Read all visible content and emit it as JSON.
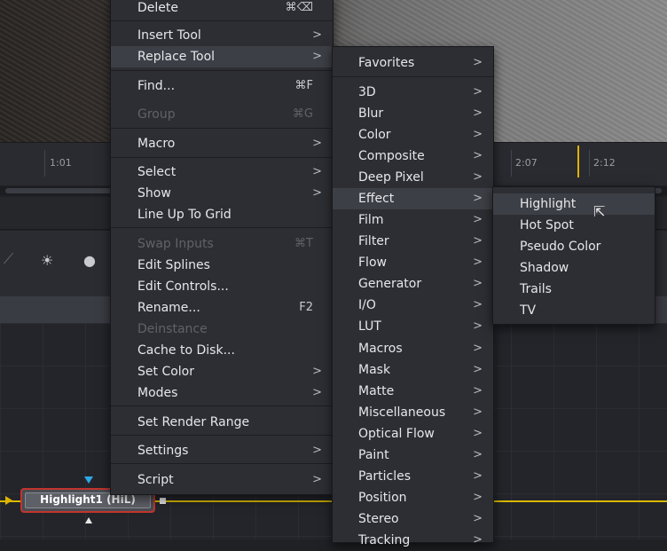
{
  "timeline": {
    "ticks": [
      "1:01",
      "2:07",
      "2:12"
    ]
  },
  "node": {
    "label": "Highlight1 (HiL)"
  },
  "context_menu": {
    "items": [
      {
        "label": "Delete",
        "shortcut": "⌘⌫",
        "disabled": false
      },
      {
        "label": "Insert Tool",
        "submenu": true
      },
      {
        "label": "Replace Tool",
        "submenu": true,
        "highlighted": true
      },
      {
        "label": "Find...",
        "shortcut": "⌘F"
      },
      {
        "label": "Group",
        "shortcut": "⌘G",
        "disabled": true
      },
      {
        "label": "Macro",
        "submenu": true
      },
      {
        "label": "Select",
        "submenu": true
      },
      {
        "label": "Show",
        "submenu": true
      },
      {
        "label": "Line Up To Grid"
      },
      {
        "label": "Swap Inputs",
        "shortcut": "⌘T",
        "disabled": true
      },
      {
        "label": "Edit Splines"
      },
      {
        "label": "Edit Controls..."
      },
      {
        "label": "Rename...",
        "shortcut": "F2"
      },
      {
        "label": "Deinstance",
        "disabled": true
      },
      {
        "label": "Cache to Disk..."
      },
      {
        "label": "Set Color",
        "submenu": true
      },
      {
        "label": "Modes",
        "submenu": true
      },
      {
        "label": "Set Render Range"
      },
      {
        "label": "Settings",
        "submenu": true
      },
      {
        "label": "Script",
        "submenu": true
      }
    ]
  },
  "replace_menu": {
    "items": [
      {
        "label": "Favorites"
      },
      {
        "label": "3D"
      },
      {
        "label": "Blur"
      },
      {
        "label": "Color"
      },
      {
        "label": "Composite"
      },
      {
        "label": "Deep Pixel"
      },
      {
        "label": "Effect",
        "highlighted": true
      },
      {
        "label": "Film"
      },
      {
        "label": "Filter"
      },
      {
        "label": "Flow"
      },
      {
        "label": "Generator"
      },
      {
        "label": "I/O"
      },
      {
        "label": "LUT"
      },
      {
        "label": "Macros"
      },
      {
        "label": "Mask"
      },
      {
        "label": "Matte"
      },
      {
        "label": "Miscellaneous"
      },
      {
        "label": "Optical Flow"
      },
      {
        "label": "Paint"
      },
      {
        "label": "Particles"
      },
      {
        "label": "Position"
      },
      {
        "label": "Stereo"
      },
      {
        "label": "Tracking"
      }
    ]
  },
  "effect_menu": {
    "items": [
      {
        "label": "Highlight",
        "highlighted": true
      },
      {
        "label": "Hot Spot"
      },
      {
        "label": "Pseudo Color"
      },
      {
        "label": "Shadow"
      },
      {
        "label": "Trails"
      },
      {
        "label": "TV"
      }
    ]
  },
  "colors": {
    "playhead": "#e0b300",
    "node_selected_border": "#c0352c",
    "connection_line": "#d8b800",
    "menu_bg": "#2d2e33",
    "menu_highlight": "#3d3f46"
  }
}
